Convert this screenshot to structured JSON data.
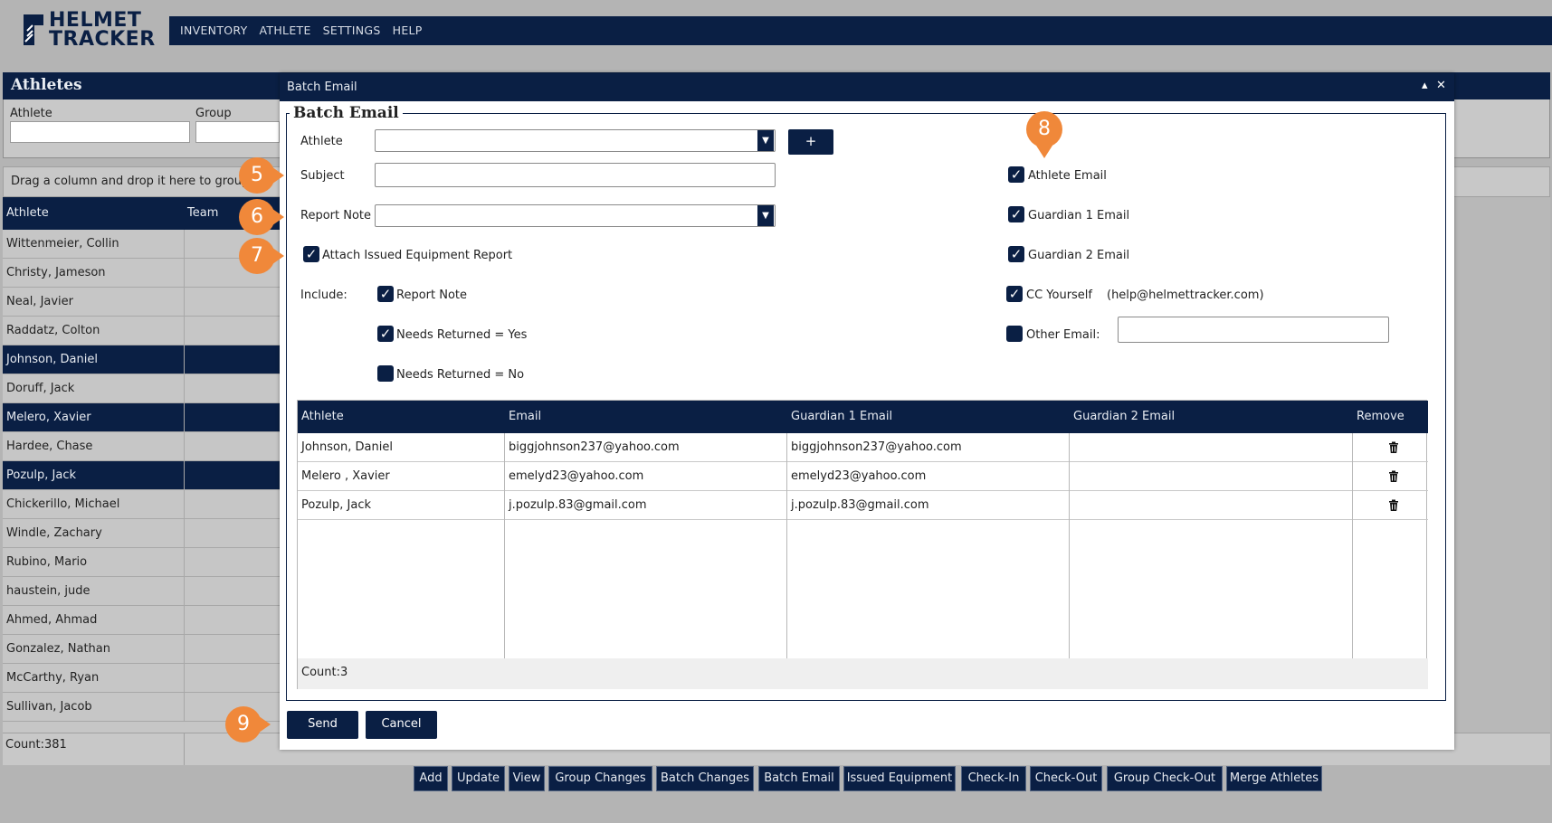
{
  "logo": {
    "line1": "HELMET",
    "line2": "TRACKER"
  },
  "nav": [
    "INVENTORY",
    "ATHLETE",
    "SETTINGS",
    "HELP"
  ],
  "athletes_panel": {
    "title": "Athletes",
    "filter_athlete_label": "Athlete",
    "filter_group_label": "Group",
    "group_bar_text": "Drag a column and drop it here to group",
    "col_athlete": "Athlete",
    "col_team": "Team",
    "rows": [
      {
        "name": "Wittenmeier, Collin",
        "selected": false
      },
      {
        "name": "Christy, Jameson",
        "selected": false
      },
      {
        "name": "Neal, Javier",
        "selected": false
      },
      {
        "name": "Raddatz, Colton",
        "selected": false
      },
      {
        "name": "Johnson, Daniel",
        "selected": true
      },
      {
        "name": "Doruff, Jack",
        "selected": false
      },
      {
        "name": "Melero, Xavier",
        "selected": true
      },
      {
        "name": "Hardee, Chase",
        "selected": false
      },
      {
        "name": "Pozulp, Jack",
        "selected": true
      },
      {
        "name": "Chickerillo, Michael",
        "selected": false
      },
      {
        "name": "Windle, Zachary",
        "selected": false
      },
      {
        "name": "Rubino, Mario",
        "selected": false
      },
      {
        "name": "haustein, jude",
        "selected": false
      },
      {
        "name": "Ahmed, Ahmad",
        "selected": false
      },
      {
        "name": "Gonzalez, Nathan",
        "selected": false
      },
      {
        "name": "McCarthy, Ryan",
        "selected": false
      },
      {
        "name": "Sullivan, Jacob",
        "selected": false
      }
    ],
    "count": "Count:381"
  },
  "toolbar": [
    "Add",
    "Update",
    "View",
    "Group Changes",
    "Batch Changes",
    "Batch Email",
    "Issued Equipment",
    "Check-In",
    "Check-Out",
    "Group Check-Out",
    "Merge Athletes"
  ],
  "modal": {
    "window_title": "Batch Email",
    "collapse_glyph": "▴",
    "close_glyph": "✕",
    "legend": "Batch Email",
    "athlete_label": "Athlete",
    "athlete_value": "",
    "add_glyph": "+",
    "subject_label": "Subject",
    "subject_value": "",
    "report_note_label": "Report Note",
    "report_note_value": "",
    "attach_report_label": "Attach Issued Equipment Report",
    "attach_report_checked": true,
    "include_label": "Include:",
    "include_report_note_label": "Report Note",
    "include_report_note_checked": true,
    "needs_returned_yes_label": "Needs Returned = Yes",
    "needs_returned_yes_checked": true,
    "needs_returned_no_label": "Needs Returned = No",
    "needs_returned_no_checked": false,
    "athlete_email_label": "Athlete Email",
    "athlete_email_checked": true,
    "guardian1_email_label": "Guardian 1 Email",
    "guardian1_email_checked": true,
    "guardian2_email_label": "Guardian 2 Email",
    "guardian2_email_checked": true,
    "cc_yourself_label": "CC Yourself",
    "cc_yourself_email": "(help@helmettracker.com)",
    "cc_yourself_checked": true,
    "other_email_label": "Other Email:",
    "other_email_checked": false,
    "other_email_value": "",
    "table": {
      "headers": [
        "Athlete",
        "Email",
        "Guardian 1 Email",
        "Guardian 2 Email",
        "Remove"
      ],
      "rows": [
        {
          "athlete": "Johnson, Daniel",
          "email": "biggjohnson237@yahoo.com",
          "guardian1": "biggjohnson237@yahoo.com",
          "guardian2": ""
        },
        {
          "athlete": "Melero , Xavier",
          "email": "emelyd23@yahoo.com",
          "guardian1": "emelyd23@yahoo.com",
          "guardian2": ""
        },
        {
          "athlete": "Pozulp, Jack",
          "email": "j.pozulp.83@gmail.com",
          "guardian1": "j.pozulp.83@gmail.com",
          "guardian2": ""
        }
      ],
      "count": "Count:3"
    },
    "send_label": "Send",
    "cancel_label": "Cancel"
  },
  "callouts": [
    "5",
    "6",
    "7",
    "8",
    "9"
  ],
  "colors": {
    "navy": "#0a1f44",
    "callout": "#f0883a",
    "background": "#b4b4b4"
  }
}
